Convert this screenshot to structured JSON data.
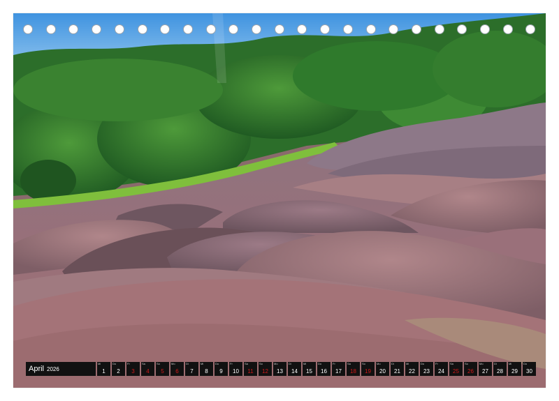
{
  "calendar": {
    "month": "April",
    "year": "2026",
    "days": [
      {
        "n": "1",
        "wd": "Mi",
        "weekend": false
      },
      {
        "n": "2",
        "wd": "Do",
        "weekend": false
      },
      {
        "n": "3",
        "wd": "Fr",
        "weekend": true
      },
      {
        "n": "4",
        "wd": "Sa",
        "weekend": true
      },
      {
        "n": "5",
        "wd": "So",
        "weekend": true
      },
      {
        "n": "6",
        "wd": "Mo",
        "weekend": true
      },
      {
        "n": "7",
        "wd": "Di",
        "weekend": false
      },
      {
        "n": "8",
        "wd": "Mi",
        "weekend": false
      },
      {
        "n": "9",
        "wd": "Do",
        "weekend": false
      },
      {
        "n": "10",
        "wd": "Fr",
        "weekend": false
      },
      {
        "n": "11",
        "wd": "Sa",
        "weekend": true
      },
      {
        "n": "12",
        "wd": "So",
        "weekend": true
      },
      {
        "n": "13",
        "wd": "Mo",
        "weekend": false
      },
      {
        "n": "14",
        "wd": "Di",
        "weekend": false
      },
      {
        "n": "15",
        "wd": "Mi",
        "weekend": false
      },
      {
        "n": "16",
        "wd": "Do",
        "weekend": false
      },
      {
        "n": "17",
        "wd": "Fr",
        "weekend": false
      },
      {
        "n": "18",
        "wd": "Sa",
        "weekend": true
      },
      {
        "n": "19",
        "wd": "So",
        "weekend": true
      },
      {
        "n": "20",
        "wd": "Mo",
        "weekend": false
      },
      {
        "n": "21",
        "wd": "Di",
        "weekend": false
      },
      {
        "n": "22",
        "wd": "Mi",
        "weekend": false
      },
      {
        "n": "23",
        "wd": "Do",
        "weekend": false
      },
      {
        "n": "24",
        "wd": "Fr",
        "weekend": false
      },
      {
        "n": "25",
        "wd": "Sa",
        "weekend": true
      },
      {
        "n": "26",
        "wd": "So",
        "weekend": true
      },
      {
        "n": "27",
        "wd": "Mo",
        "weekend": false
      },
      {
        "n": "28",
        "wd": "Di",
        "weekend": false
      },
      {
        "n": "29",
        "wd": "Mi",
        "weekend": false
      },
      {
        "n": "30",
        "wd": "Do",
        "weekend": false
      }
    ]
  },
  "colors": {
    "sky": "#4a9be0",
    "forest": "#2f7a2c",
    "earth_pink": "#9a6e74",
    "earth_mauve": "#7a5d66",
    "weekend": "#d11a1a",
    "strip": "#111111"
  }
}
